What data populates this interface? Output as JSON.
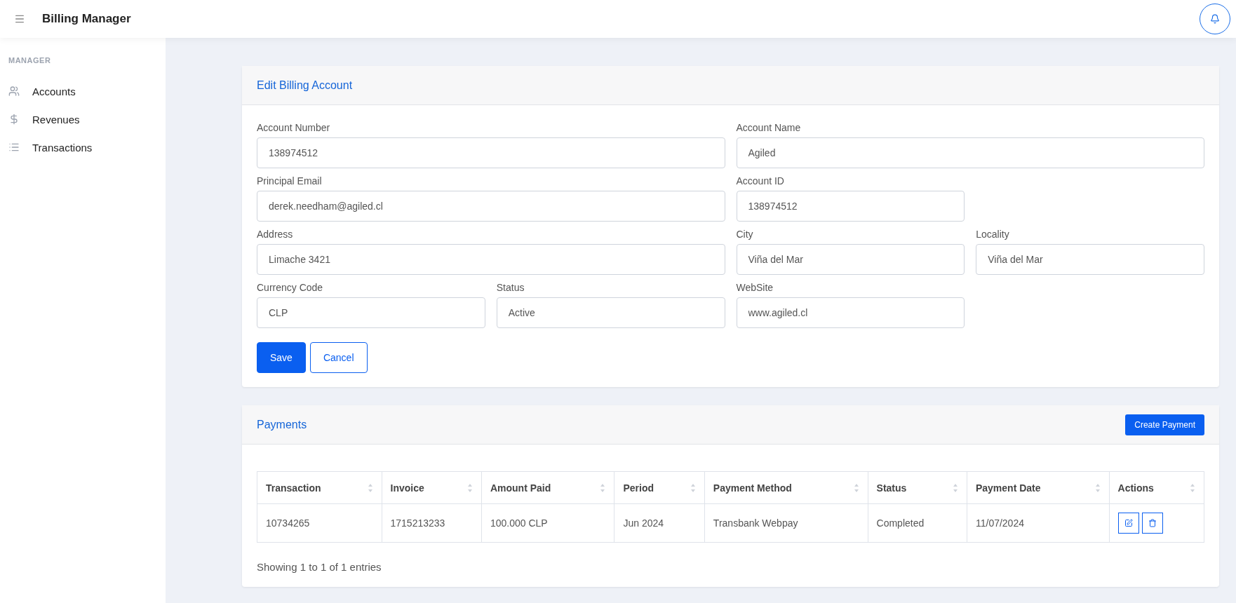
{
  "header": {
    "title": "Billing Manager"
  },
  "sidebar": {
    "section": "MANAGER",
    "items": [
      {
        "label": "Accounts",
        "kind": "users"
      },
      {
        "label": "Revenues",
        "kind": "dollar"
      },
      {
        "label": "Transactions",
        "kind": "list"
      }
    ]
  },
  "edit_card": {
    "title": "Edit Billing Account",
    "fields": [
      {
        "label": "Account Number",
        "value": "138974512",
        "kind": "wide"
      },
      {
        "label": "Account Name",
        "value": "Agiled",
        "kind": "wide"
      },
      {
        "label": "Principal Email",
        "value": "derek.needham@agiled.cl",
        "kind": "wide"
      },
      {
        "label": "Account ID",
        "value": "138974512",
        "kind": "narrow"
      },
      {
        "label": "Address",
        "value": "Limache 3421",
        "kind": "wide"
      },
      {
        "label": "City",
        "value": "Viña del Mar",
        "kind": "narrow"
      },
      {
        "label": "Locality",
        "value": "Viña del Mar",
        "kind": "narrow"
      },
      {
        "label": "Currency Code",
        "value": "CLP",
        "kind": "narrow"
      },
      {
        "label": "Status",
        "value": "Active",
        "kind": "narrow"
      },
      {
        "label": "WebSite",
        "value": "www.agiled.cl",
        "kind": "narrow"
      }
    ],
    "buttons": [
      {
        "label": "Save",
        "kind": "primary"
      },
      {
        "label": "Cancel",
        "kind": "outline"
      }
    ]
  },
  "payments_card": {
    "title": "Payments",
    "create_button": "Create Payment",
    "table": {
      "columns": [
        "Transaction",
        "Invoice",
        "Amount Paid",
        "Period",
        "Payment Method",
        "Status",
        "Payment Date",
        "Actions"
      ],
      "rows": [
        {
          "cells": [
            "10734265",
            "1715213233",
            "100.000 CLP",
            "Jun 2024",
            "Transbank Webpay",
            "Completed",
            "11/07/2024"
          ]
        }
      ]
    },
    "footer": "Showing 1 to 1 of 1 entries"
  }
}
